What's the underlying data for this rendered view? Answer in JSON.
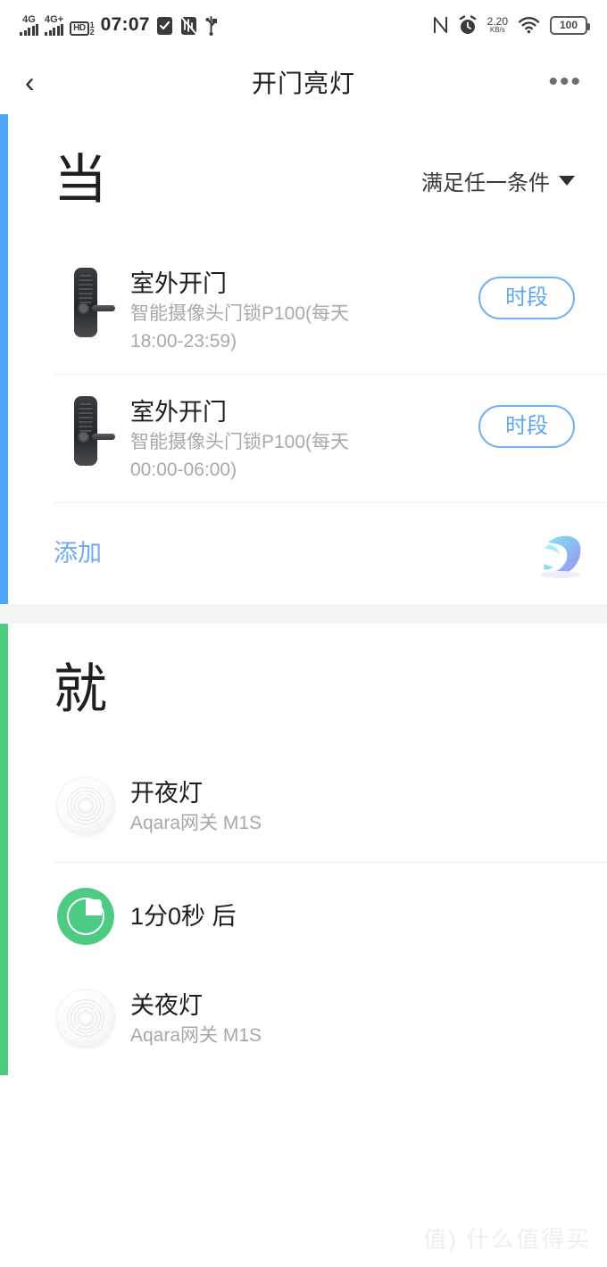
{
  "statusbar": {
    "network_1": "4G",
    "network_2": "4G+",
    "hd_label": "HD",
    "hd_sup": "1",
    "hd_sub": "2",
    "time": "07:07",
    "icons": [
      "clipboard-check-icon",
      "vibrate-off-icon",
      "usb-icon",
      "nfc-icon",
      "alarm-icon",
      "wifi-icon"
    ],
    "netspeed_value": "2.20",
    "netspeed_unit": "KB/s",
    "battery": "100"
  },
  "navbar": {
    "back": "‹",
    "title": "开门亮灯",
    "more": "•••"
  },
  "colors": {
    "accent_condition": "#4DA6F7",
    "accent_action": "#4ECB83",
    "link": "#6FA8F5",
    "pill_border": "#6FB1F2",
    "pill_text": "#5CA8EE"
  },
  "condition_section": {
    "heading": "当",
    "match_mode": "满足任一条件",
    "caret": "caret-down-icon",
    "items": [
      {
        "icon": "door-lock-icon",
        "title": "室外开门",
        "subtitle": "智能摄像头门锁P100(每天 18:00-23:59)",
        "badge": "时段"
      },
      {
        "icon": "door-lock-icon",
        "title": "室外开门",
        "subtitle": "智能摄像头门锁P100(每天 00:00-06:00)",
        "badge": "时段"
      }
    ],
    "add_label": "添加"
  },
  "action_section": {
    "heading": "就",
    "items": [
      {
        "icon": "aqara-gateway-icon",
        "title": "开夜灯",
        "subtitle": "Aqara网关 M1S"
      },
      {
        "icon": "timer-icon",
        "title": "1分0秒 后",
        "subtitle": ""
      },
      {
        "icon": "aqara-gateway-icon",
        "title": "关夜灯",
        "subtitle": "Aqara网关 M1S"
      }
    ]
  },
  "watermarks": {
    "logo": "dolphin-logo-icon",
    "text": "值) 什么值得买"
  }
}
